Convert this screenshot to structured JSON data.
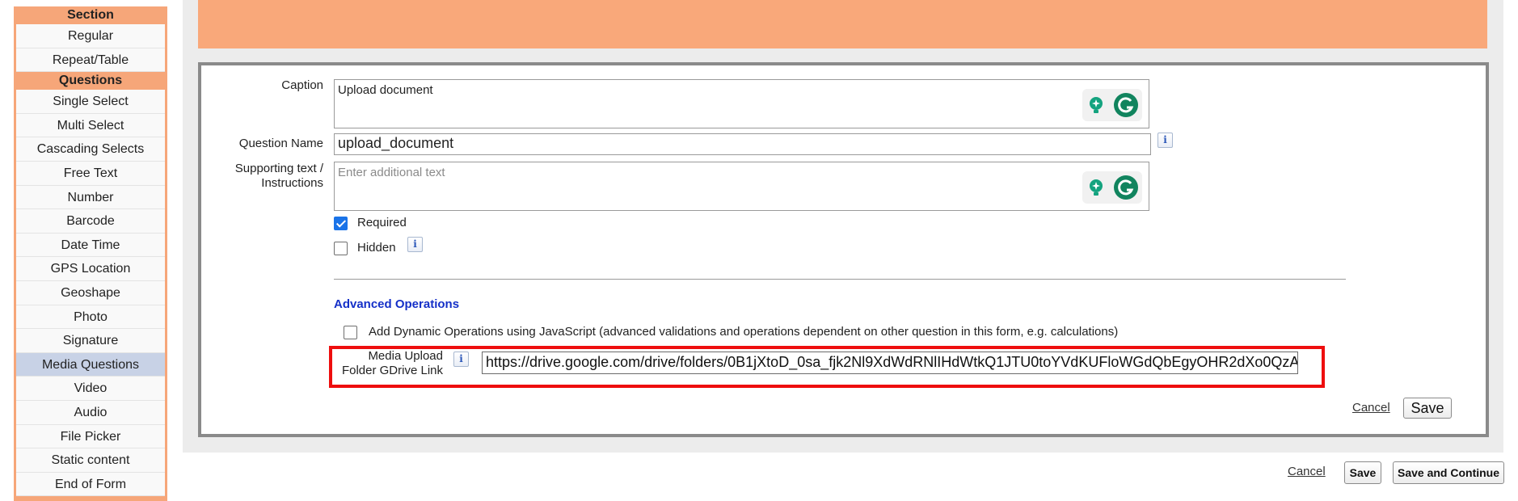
{
  "sidebar": {
    "section_header": "Section",
    "section_items": [
      "Regular",
      "Repeat/Table"
    ],
    "questions_header": "Questions",
    "question_items": [
      "Single Select",
      "Multi Select",
      "Cascading Selects",
      "Free Text",
      "Number",
      "Barcode",
      "Date Time",
      "GPS Location",
      "Geoshape",
      "Photo",
      "Signature",
      "Media Questions",
      "Video",
      "Audio",
      "File Picker",
      "Static content",
      "End of Form"
    ],
    "active_item": "Media Questions"
  },
  "form": {
    "caption_label": "Caption",
    "caption_value": "Upload document",
    "question_name_label": "Question Name",
    "question_name_value": "upload_document",
    "supporting_label_line1": "Supporting text /",
    "supporting_label_line2": "Instructions",
    "supporting_placeholder": "Enter additional text",
    "required_label": "Required",
    "required_checked": true,
    "hidden_label": "Hidden",
    "hidden_checked": false,
    "advanced_title": "Advanced Operations",
    "dynamic_ops_label": "Add Dynamic Operations using JavaScript (advanced validations and operations dependent on other question in this form, e.g. calculations)",
    "dynamic_ops_checked": false,
    "media_label_line1": "Media Upload",
    "media_label_line2": "Folder GDrive Link",
    "media_url_value": "https://drive.google.com/drive/folders/0B1jXtoD_0sa_fjk2Nl9XdWdRNlIHdWtkQ1JTU0toYVdKUFloWGdQbEgyOHR2dXo0QzA",
    "info_glyph": "i",
    "cancel_label": "Cancel",
    "save_label": "Save"
  },
  "footer": {
    "cancel_label": "Cancel",
    "save_label": "Save",
    "save_continue_label": "Save and Continue"
  },
  "colors": {
    "accent_orange": "#f6a679",
    "advanced_title": "#1530c8",
    "highlight_red": "#ee0e0e",
    "checkbox_blue": "#1a73e8",
    "active_sidebar": "#c8d2e6"
  }
}
